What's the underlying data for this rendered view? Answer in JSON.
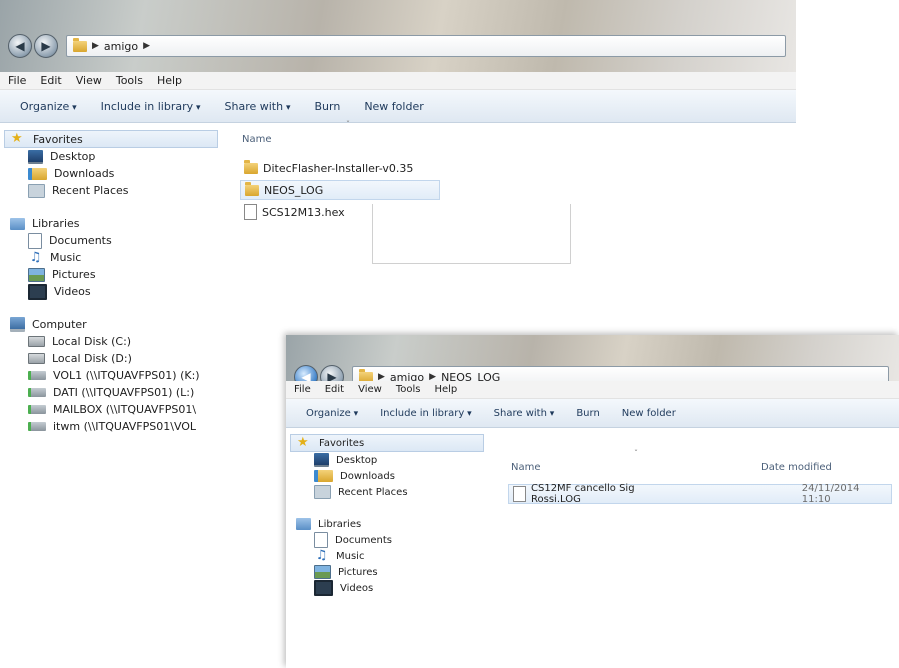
{
  "window1": {
    "breadcrumb": [
      "amigo"
    ],
    "menu": [
      "File",
      "Edit",
      "View",
      "Tools",
      "Help"
    ],
    "toolbar": {
      "organize": "Organize",
      "include_in_library": "Include in library",
      "share_with": "Share with",
      "burn": "Burn",
      "new_folder": "New folder"
    },
    "nav": {
      "favorites": "Favorites",
      "desktop": "Desktop",
      "downloads": "Downloads",
      "recent_places": "Recent Places",
      "libraries": "Libraries",
      "documents": "Documents",
      "music": "Music",
      "pictures": "Pictures",
      "videos": "Videos",
      "computer": "Computer",
      "drives": [
        "Local Disk (C:)",
        "Local Disk (D:)",
        "VOL1 (\\\\ITQUAVFPS01) (K:)",
        "DATI (\\\\ITQUAVFPS01) (L:)",
        "MAILBOX (\\\\ITQUAVFPS01\\",
        "itwm (\\\\ITQUAVFPS01\\VOL"
      ]
    },
    "column_name": "Name",
    "files": [
      "DitecFlasher-Installer-v0.35",
      "NEOS_LOG",
      "SCS12M13.hex"
    ]
  },
  "window2": {
    "breadcrumb": [
      "amigo",
      "NEOS_LOG"
    ],
    "menu": [
      "File",
      "Edit",
      "View",
      "Tools",
      "Help"
    ],
    "toolbar": {
      "organize": "Organize",
      "include_in_library": "Include in library",
      "share_with": "Share with",
      "burn": "Burn",
      "new_folder": "New folder"
    },
    "nav": {
      "favorites": "Favorites",
      "desktop": "Desktop",
      "downloads": "Downloads",
      "recent_places": "Recent Places",
      "libraries": "Libraries",
      "documents": "Documents",
      "music": "Music",
      "pictures": "Pictures",
      "videos": "Videos"
    },
    "column_name": "Name",
    "column_date": "Date modified",
    "files": [
      {
        "name": "CS12MF cancello Sig Rossi.LOG",
        "date": "24/11/2014 11:10"
      }
    ]
  }
}
